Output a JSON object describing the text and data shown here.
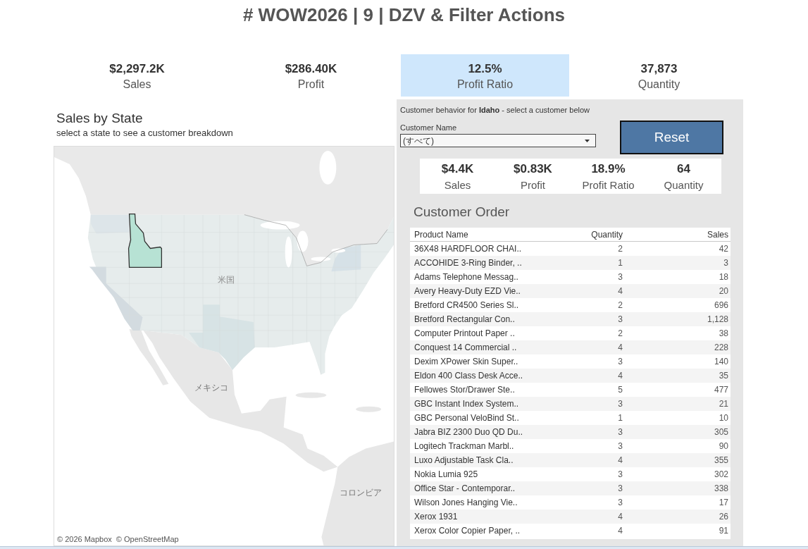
{
  "title": "# WOW2026 | 9 | DZV & Filter Actions",
  "kpis": [
    {
      "value": "$2,297.2K",
      "label": "Sales",
      "selected": false
    },
    {
      "value": "$286.40K",
      "label": "Profit",
      "selected": false
    },
    {
      "value": "12.5%",
      "label": "Profit Ratio",
      "selected": true
    },
    {
      "value": "37,873",
      "label": "Quantity",
      "selected": false
    }
  ],
  "map_panel": {
    "title": "Sales by State",
    "subtitle": "select a state to see a customer breakdown",
    "labels": [
      "米国",
      "メキシコ",
      "コロンビア"
    ],
    "attribution": [
      "© 2026 Mapbox",
      "© OpenStreetMap"
    ]
  },
  "customer_panel": {
    "caption": "Customer behavior for **Idaho** - select a customer below",
    "filter": {
      "label": "Customer Name",
      "value": "(すべて)"
    },
    "reset_button": "Reset",
    "kpis": [
      {
        "value": "$4.4K",
        "label": "Sales"
      },
      {
        "value": "$0.83K",
        "label": "Profit"
      },
      {
        "value": "18.9%",
        "label": "Profit Ratio"
      },
      {
        "value": "64",
        "label": "Quantity"
      }
    ],
    "table": {
      "title": "Customer Order",
      "columns": [
        "Product Name",
        "Quantity",
        "Sales"
      ],
      "rows": [
        [
          "36X48 HARDFLOOR CHAI..",
          "2",
          "42"
        ],
        [
          "ACCOHIDE 3-Ring Binder, ..",
          "1",
          "3"
        ],
        [
          "Adams Telephone Messag..",
          "3",
          "18"
        ],
        [
          "Avery Heavy-Duty EZD Vie..",
          "4",
          "20"
        ],
        [
          "Bretford CR4500 Series Sl..",
          "2",
          "696"
        ],
        [
          "Bretford Rectangular Con..",
          "3",
          "1,128"
        ],
        [
          "Computer Printout Paper ..",
          "2",
          "38"
        ],
        [
          "Conquest 14 Commercial ..",
          "4",
          "228"
        ],
        [
          "Dexim XPower Skin Super..",
          "3",
          "140"
        ],
        [
          "Eldon 400 Class Desk Acce..",
          "4",
          "35"
        ],
        [
          "Fellowes Stor/Drawer Ste..",
          "5",
          "477"
        ],
        [
          "GBC Instant Index System..",
          "3",
          "21"
        ],
        [
          "GBC Personal VeloBind St..",
          "1",
          "10"
        ],
        [
          "Jabra BIZ 2300 Duo QD Du..",
          "3",
          "305"
        ],
        [
          "Logitech Trackman Marbl..",
          "3",
          "90"
        ],
        [
          "Luxo Adjustable Task Cla..",
          "4",
          "355"
        ],
        [
          "Nokia Lumia 925",
          "3",
          "302"
        ],
        [
          "Office Star - Contemporar..",
          "3",
          "338"
        ],
        [
          "Wilson Jones Hanging Vie..",
          "3",
          "17"
        ],
        [
          "Xerox 1931",
          "4",
          "26"
        ],
        [
          "Xerox Color Copier Paper, ..",
          "4",
          "91"
        ]
      ]
    }
  }
}
